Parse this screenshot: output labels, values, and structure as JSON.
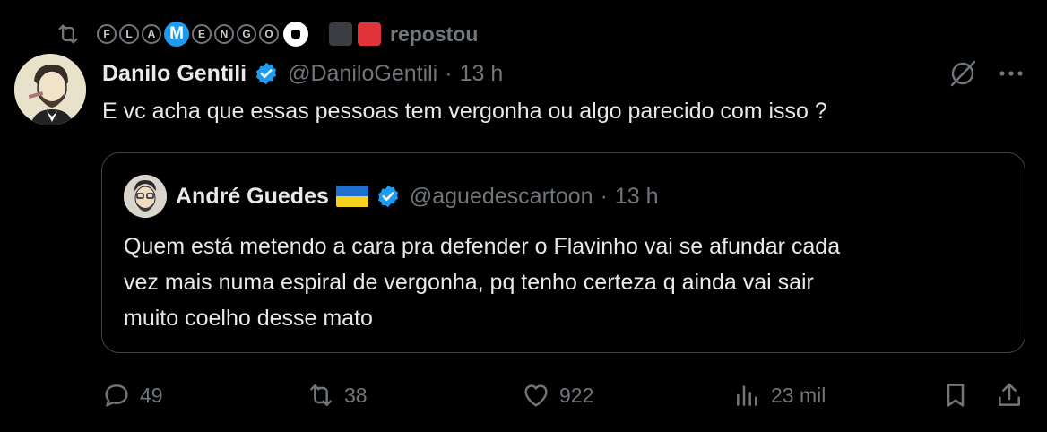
{
  "repost": {
    "icon": "repost-icon",
    "name_letters": [
      "F",
      "L",
      "A",
      "M",
      "E",
      "N",
      "G",
      "O"
    ],
    "label": "repostou"
  },
  "tweet": {
    "author_name": "Danilo Gentili",
    "handle": "@DaniloGentili",
    "separator": "·",
    "time": "13 h",
    "text": "E vc acha que essas pessoas tem vergonha ou algo parecido com isso ?"
  },
  "quote": {
    "author_name": "André Guedes",
    "handle": "@aguedescartoon",
    "separator": "·",
    "time": "13 h",
    "text_lines": [
      "Quem está metendo a cara pra defender o Flavinho vai se afundar cada",
      "vez mais numa espiral de vergonha, pq tenho certeza q ainda vai sair",
      "muito coelho desse mato"
    ]
  },
  "actions": {
    "replies": "49",
    "reposts": "38",
    "likes": "922",
    "views": "23 mil"
  },
  "colors": {
    "background": "#000000",
    "text": "#e7e9ea",
    "muted": "#71767b",
    "verified": "#1d9bf0",
    "border": "#3e4347"
  }
}
